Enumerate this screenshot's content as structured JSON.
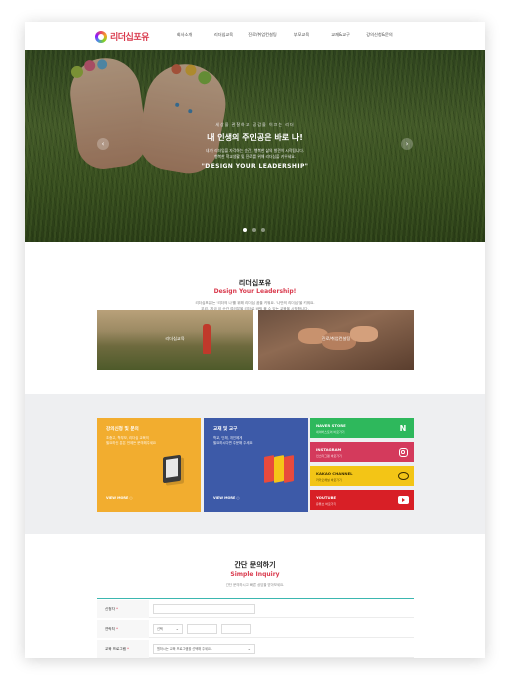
{
  "header": {
    "logo_text": "리더십포유",
    "nav": [
      "회사소개",
      "리더십교육",
      "진로/취업컨설팅",
      "부모교육",
      "교재&교구",
      "강의신청&문의"
    ]
  },
  "hero": {
    "small_text": "세상을 관찰하고 공감을 이끄는 리더",
    "title": "내 인생의 주인공은 바로 나!",
    "sub_line1": "내가 리더임을 자각하는 순간, 행복한 삶의 발견이 시작됩니다.",
    "sub_line2": "행복한 학교생활 및 진로를 위해 리더십을 키우세요.",
    "quote": "\"DESIGN YOUR LEADERSHIP\"",
    "slide_count": 3,
    "active_slide": 1
  },
  "intro": {
    "title": "리더십포유",
    "subtitle": "Design Your Leadership!",
    "desc_line1": "리더십포유는 '리더의 나'를 위해 리더십 꿈을 키워요. '나만의 리더십'을 키워요.",
    "desc_line2": "우리, 지금 이 순간 여러분을 리더로 바꿔 볼 수 있는 교육을 시작합니다.",
    "photos": [
      {
        "label": "리더십교육"
      },
      {
        "label": "진로/취업컨설팅"
      }
    ]
  },
  "cards": {
    "orange": {
      "title": "강의신청 및 문의",
      "desc_line1": "초중고, 학부모, 리더십 교육의",
      "desc_line2": "필요하신 분은 언제든 문의해주세요",
      "more": "VIEW MORE"
    },
    "blue": {
      "title": "교재 및 교구",
      "desc_line1": "학교, 단체, 개인에게",
      "desc_line2": "필요하시다면 주문해 주세요",
      "more": "VIEW MORE"
    }
  },
  "social": [
    {
      "title": "NAVER STORE",
      "desc": "네이버스토어 바로가기",
      "icon": "naver-icon",
      "color": "#2eb85c"
    },
    {
      "title": "INSTAGRAM",
      "desc": "인스타그램 바로가기",
      "icon": "instagram-icon",
      "color": "#d43a5c"
    },
    {
      "title": "KAKAO CHANNEL",
      "desc": "카카오채널 바로가기",
      "icon": "kakao-icon",
      "color": "#f3c516"
    },
    {
      "title": "YOUTUBE",
      "desc": "유튜브 바로가기",
      "icon": "youtube-icon",
      "color": "#d81f26"
    }
  ],
  "inquiry": {
    "title": "간단 문의하기",
    "subtitle": "Simple Inquiry",
    "desc": "간단 문의하시고 빠른 상담을 받아보세요.",
    "fields": {
      "name_label": "신청자",
      "phone_label": "연락처",
      "phone_prefix": "선택",
      "program_label": "교육 프로그램",
      "program_placeholder": "원하시는 교육 프로그램을 선택해 주세요."
    }
  },
  "colors": {
    "accent": "#d9394c",
    "teal": "#3bb7b0",
    "orange": "#f2ad2f",
    "blue": "#3d5aa8"
  }
}
